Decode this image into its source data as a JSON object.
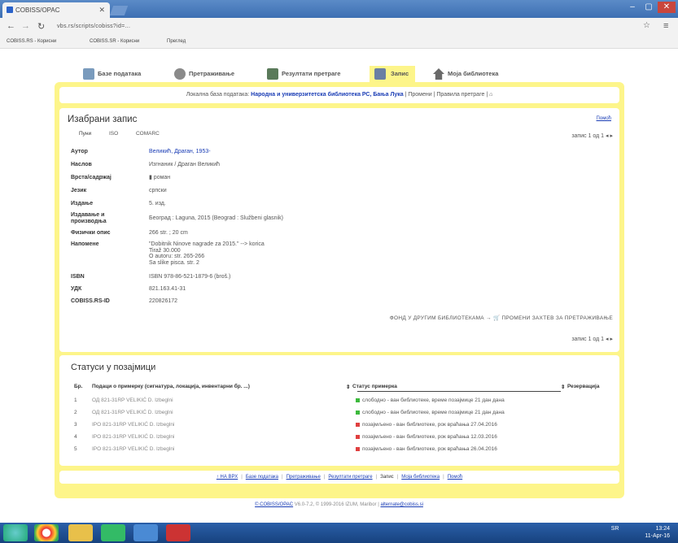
{
  "browser": {
    "tab_title": "COBISS/OPAC",
    "url": "vbs.rs/scripts/cobiss?id=...",
    "bookmarks": [
      "COBISS.RS - Корисни",
      "COBISS.SR - Корисни",
      "Преглед"
    ]
  },
  "menu": [
    {
      "label": "Базе података",
      "color": "#7a9bbd"
    },
    {
      "label": "Претраживање",
      "color": "#8a8a8a"
    },
    {
      "label": "Резултати претраге",
      "color": "#5a7a5a"
    },
    {
      "label": "Запис",
      "color": "#6a7fa3",
      "active": true
    },
    {
      "label": "Моја библиотека",
      "color": "#6a6a6a"
    }
  ],
  "info": {
    "prefix": "Локална база података: ",
    "library": "Народна и универзитетска библиотека РС, Бања Лука",
    "suffix": " | Промени | Правила претраге | ⌂"
  },
  "record": {
    "title": "Изабрани запис",
    "help": "Помоћ",
    "subtabs": [
      "Пуни",
      "ISO",
      "COMARC"
    ],
    "nav_top": "запис 1 од 1  ◂ ▸",
    "nav_bottom": "запис 1 од 1  ◂ ▸",
    "fields": [
      {
        "label": "Аутор",
        "value": "Великић, Драган, 1953-",
        "link": true
      },
      {
        "label": "Наслов",
        "value": "Изгнаник / Драган Великић"
      },
      {
        "label": "Врста/садржај",
        "value": "роман"
      },
      {
        "label": "Језик",
        "value": "српски"
      },
      {
        "label": "Издање",
        "value": "5. изд."
      },
      {
        "label": "Издавање и производња",
        "value": "Београд : Laguna, 2015 (Beograd : Službeni glasnik)"
      },
      {
        "label": "Физички опис",
        "value": "266 str. ; 20 cm"
      },
      {
        "label": "Напомене",
        "value": "\"Dobitnik Ninove nagrade za 2015.\" --> korica\nTiraž 30.000\nO autoru: str. 265-266\nSa slike pisca. str. 2"
      },
      {
        "label": "ISBN",
        "value": "ISBN 978-86-521-1879-6 (broš.)"
      },
      {
        "label": "УДК",
        "value": "821.163.41-31"
      },
      {
        "label": "COBISS.RS-ID",
        "value": "220826172"
      }
    ],
    "actions": "ФОНД У ДРУГИМ БИБЛИОТЕКАМА  →  🛒  ПРОМЕНИ ЗАХТЕВ ЗА ПРЕТРАЖИВАЊЕ"
  },
  "holdings": {
    "title": "Статуси у позајмици",
    "col_no": "Бр.",
    "col_copy": "Подаци о примерку (сигнатура, локација, инвентарни бр. ...)",
    "col_status": "Статус примерка",
    "col_reserve": "Резервација",
    "rows": [
      {
        "no": "1",
        "copy": "ОД 821-31RP VELIKIĆ D. Izbeglni",
        "status": "слободно - ван библиотеке, време позајмице 21 дан дана",
        "color": "#3cb93c"
      },
      {
        "no": "2",
        "copy": "ОД 821-31RP VELIKIĆ D. Izbeglni",
        "status": "слободно - ван библиотеке, време позајмице 21 дан дана",
        "color": "#3cb93c"
      },
      {
        "no": "3",
        "copy": "IPO 821-31RP VELIKIĆ D. Izbeglni",
        "status": "позајмљено - ван библиотеке, рок враћања 27.04.2016",
        "color": "#e04040"
      },
      {
        "no": "4",
        "copy": "IPO 821-31RP VELIKIĆ D. Izbeglni",
        "status": "позајмљено - ван библиотеке, рок враћања 12.03.2016",
        "color": "#e04040"
      },
      {
        "no": "5",
        "copy": "IPO 821-31RP VELIKIĆ D. Izbeglni",
        "status": "позајмљено - ван библиотеке, рок враћања 26.04.2016",
        "color": "#e04040"
      }
    ]
  },
  "footer_nav": [
    "↑ НА ВРХ",
    "Базе података",
    "Претраживање",
    "Резултати претраге",
    "Запис",
    "Моја библиотека",
    "Помоћ"
  ],
  "footer_current": "Запис",
  "copyright": {
    "link": "© COBISS/OPAC",
    "text": " V6.0-7.2, © 1999-2016 IZUM, Maribor | ",
    "mail": "alternate@cobiss.si"
  },
  "tray": {
    "lang": "SR",
    "time": "13:24",
    "date": "11-Apr-16"
  }
}
